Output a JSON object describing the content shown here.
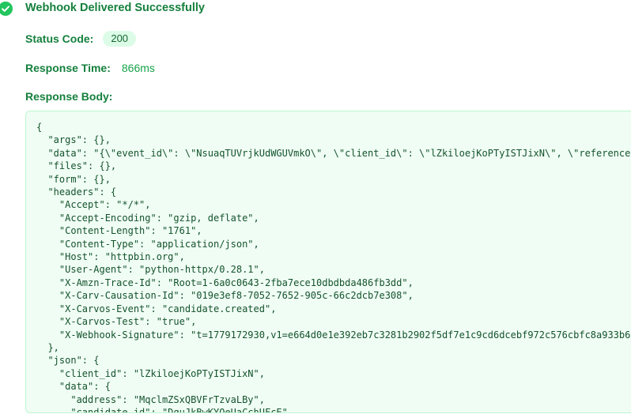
{
  "header": {
    "title": "Webhook Delivered Successfully",
    "icon": "check-circle-icon",
    "icon_color": "#22c55e"
  },
  "status": {
    "label": "Status Code:",
    "value": "200"
  },
  "response_time": {
    "label": "Response Time:",
    "value": "866ms"
  },
  "response_body": {
    "label": "Response Body:",
    "text": "{\n  \"args\": {},\n  \"data\": \"{\\\"event_id\\\": \\\"NsuaqTUVrjkUdWGUVmkO\\\", \\\"client_id\\\": \\\"lZkiloejKoPTyISTJixN\\\", \\\"reference\n  \"files\": {},\n  \"form\": {},\n  \"headers\": {\n    \"Accept\": \"*/*\",\n    \"Accept-Encoding\": \"gzip, deflate\",\n    \"Content-Length\": \"1761\",\n    \"Content-Type\": \"application/json\",\n    \"Host\": \"httpbin.org\",\n    \"User-Agent\": \"python-httpx/0.28.1\",\n    \"X-Amzn-Trace-Id\": \"Root=1-6a0c0643-2fba7ece10dbdbda486fb3dd\",\n    \"X-Carv-Causation-Id\": \"019e3ef8-7052-7652-905c-66c2dcb7e308\",\n    \"X-Carvos-Event\": \"candidate.created\",\n    \"X-Carvos-Test\": \"true\",\n    \"X-Webhook-Signature\": \"t=1779172930,v1=e664d0e1e392eb7c3281b2902f5df7e1c9cd6dcebf972c576cbfc8a933b6\n  },\n  \"json\": {\n    \"client_id\": \"lZkiloejKoPTyISTJixN\",\n    \"data\": {\n      \"address\": \"MqclmZSxQBVFrTzvaLBy\",\n      \"candidate_id\": \"DquJkBwKYOeUaCchUFcE\","
  },
  "colors": {
    "accent": "#15803d",
    "badge_bg": "#dcfce7",
    "code_bg": "#f0fdf4",
    "code_border": "#bbf7d0"
  }
}
